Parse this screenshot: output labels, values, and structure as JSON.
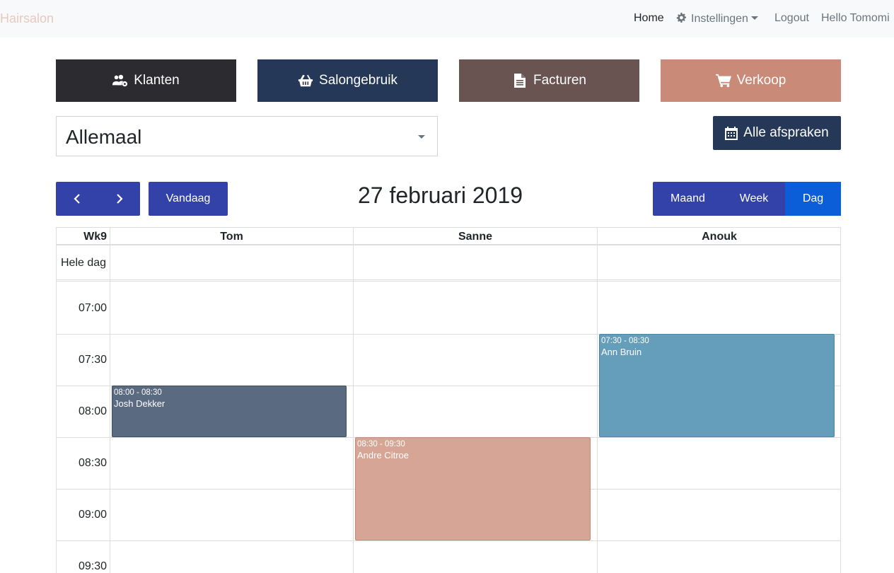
{
  "navbar": {
    "brand": "Hairsalon",
    "home": "Home",
    "settings": "Instellingen",
    "logout": "Logout",
    "hello": "Hello Tomomi"
  },
  "actions": {
    "klanten": "Klanten",
    "salongebruik": "Salongebruik",
    "facturen": "Facturen",
    "verkoop": "Verkoop"
  },
  "filter": {
    "selected": "Allemaal"
  },
  "all_appointments": "Alle afspraken",
  "calendar": {
    "today_label": "Vandaag",
    "title": "27 februari 2019",
    "views": {
      "month": "Maand",
      "week": "Week",
      "day": "Dag"
    },
    "week_number": "Wk9",
    "all_day_label": "Hele dag",
    "resources": [
      "Tom",
      "Sanne",
      "Anouk"
    ],
    "times": [
      "07:00",
      "07:30",
      "08:00",
      "08:30",
      "09:00",
      "09:30"
    ],
    "events": [
      {
        "time": "08:00 - 08:30",
        "name": "Josh Dekker",
        "resource": "Tom",
        "color": "#5a6a80"
      },
      {
        "time": "08:30 - 09:30",
        "name": "Andre Citroe",
        "resource": "Sanne",
        "color": "#d6a595"
      },
      {
        "time": "07:30 - 08:30",
        "name": "Ann Bruin",
        "resource": "Anouk",
        "color": "#649eba"
      }
    ]
  },
  "colors": {
    "klanten": "#2c2b2f",
    "salongebruik": "#253858",
    "facturen": "#6a5452",
    "verkoop": "#c98a77",
    "primary": "#3342a8",
    "active_view": "#0b5ed7"
  }
}
